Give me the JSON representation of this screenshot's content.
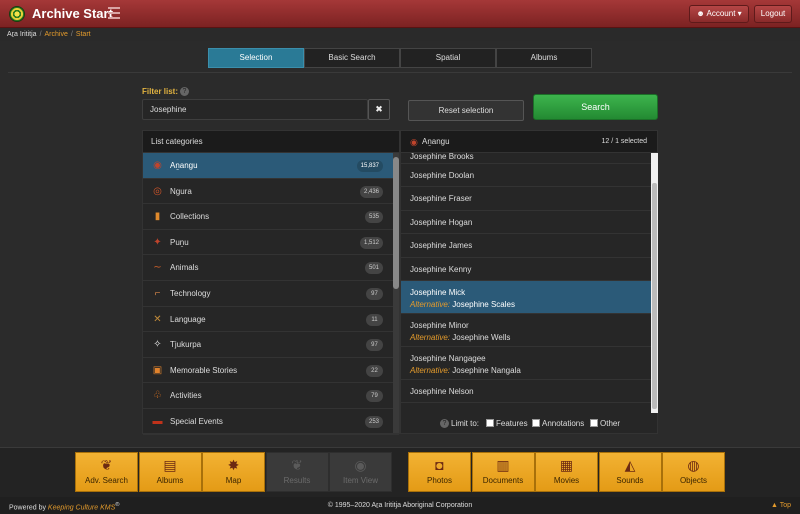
{
  "header": {
    "title": "Archive Start",
    "account_label": "Account",
    "logout_label": "Logout"
  },
  "breadcrumb": {
    "root": "Aṟa Irititja",
    "archive": "Archive",
    "current": "Start"
  },
  "tabs": [
    {
      "label": "Selection",
      "active": true
    },
    {
      "label": "Basic Search"
    },
    {
      "label": "Spatial"
    },
    {
      "label": "Albums"
    }
  ],
  "filter": {
    "label": "Filter list:",
    "value": "Josephine"
  },
  "buttons": {
    "reset": "Reset selection",
    "search": "Search"
  },
  "categories": {
    "header": "List categories",
    "items": [
      {
        "label": "Aṉangu",
        "count": "15,837",
        "icon": "person-icon",
        "active": true
      },
      {
        "label": "Ngura",
        "count": "2,436",
        "icon": "place-icon"
      },
      {
        "label": "Collections",
        "count": "535",
        "icon": "collection-icon"
      },
      {
        "label": "Puṉu",
        "count": "1,512",
        "icon": "wood-icon"
      },
      {
        "label": "Animals",
        "count": "501",
        "icon": "animal-icon"
      },
      {
        "label": "Technology",
        "count": "97",
        "icon": "boomerang-icon"
      },
      {
        "label": "Language",
        "count": "11",
        "icon": "language-icon"
      },
      {
        "label": "Tjukurpa",
        "count": "97",
        "icon": "stars-icon"
      },
      {
        "label": "Memorable Stories",
        "count": "22",
        "icon": "stories-icon"
      },
      {
        "label": "Activities",
        "count": "79",
        "icon": "activity-icon"
      },
      {
        "label": "Special Events",
        "count": "253",
        "icon": "flag-icon"
      }
    ]
  },
  "names": {
    "header": "Aṉangu",
    "selected": "12 / 1 selected",
    "alt_label": "Alternative:",
    "partial": "Josephine Brooks",
    "items": [
      {
        "name": "Josephine Doolan"
      },
      {
        "name": "Josephine Fraser"
      },
      {
        "name": "Josephine Hogan"
      },
      {
        "name": "Josephine James"
      },
      {
        "name": "Josephine Kenny"
      },
      {
        "name": "Josephine Mick",
        "alt": "Josephine Scales",
        "active": true
      },
      {
        "name": "Josephine Minor",
        "alt": "Josephine Wells"
      },
      {
        "name": "Josephine Nangagee",
        "alt": "Josephine Nangala"
      },
      {
        "name": "Josephine Nelson"
      }
    ],
    "limit_label": "Limit to:",
    "limit_options": [
      "Features",
      "Annotations",
      "Other"
    ]
  },
  "nav_left": [
    {
      "label": "Adv. Search",
      "icon": "leaf-icon"
    },
    {
      "label": "Albums",
      "icon": "album-icon"
    },
    {
      "label": "Map",
      "icon": "map-icon"
    },
    {
      "label": "Results",
      "icon": "results-icon",
      "disabled": true
    },
    {
      "label": "Item View",
      "icon": "eye-icon",
      "disabled": true
    }
  ],
  "nav_right": [
    {
      "label": "Photos",
      "icon": "camera-icon"
    },
    {
      "label": "Documents",
      "icon": "documents-icon"
    },
    {
      "label": "Movies",
      "icon": "film-icon"
    },
    {
      "label": "Sounds",
      "icon": "sound-icon"
    },
    {
      "label": "Objects",
      "icon": "object-icon"
    }
  ],
  "footer": {
    "powered_prefix": "Powered by",
    "powered_brand": "Keeping Culture KMS",
    "reg": "®",
    "copyright": "© 1995–2020 Aṟa Irititja Aboriginal Corporation",
    "top": "Top"
  }
}
